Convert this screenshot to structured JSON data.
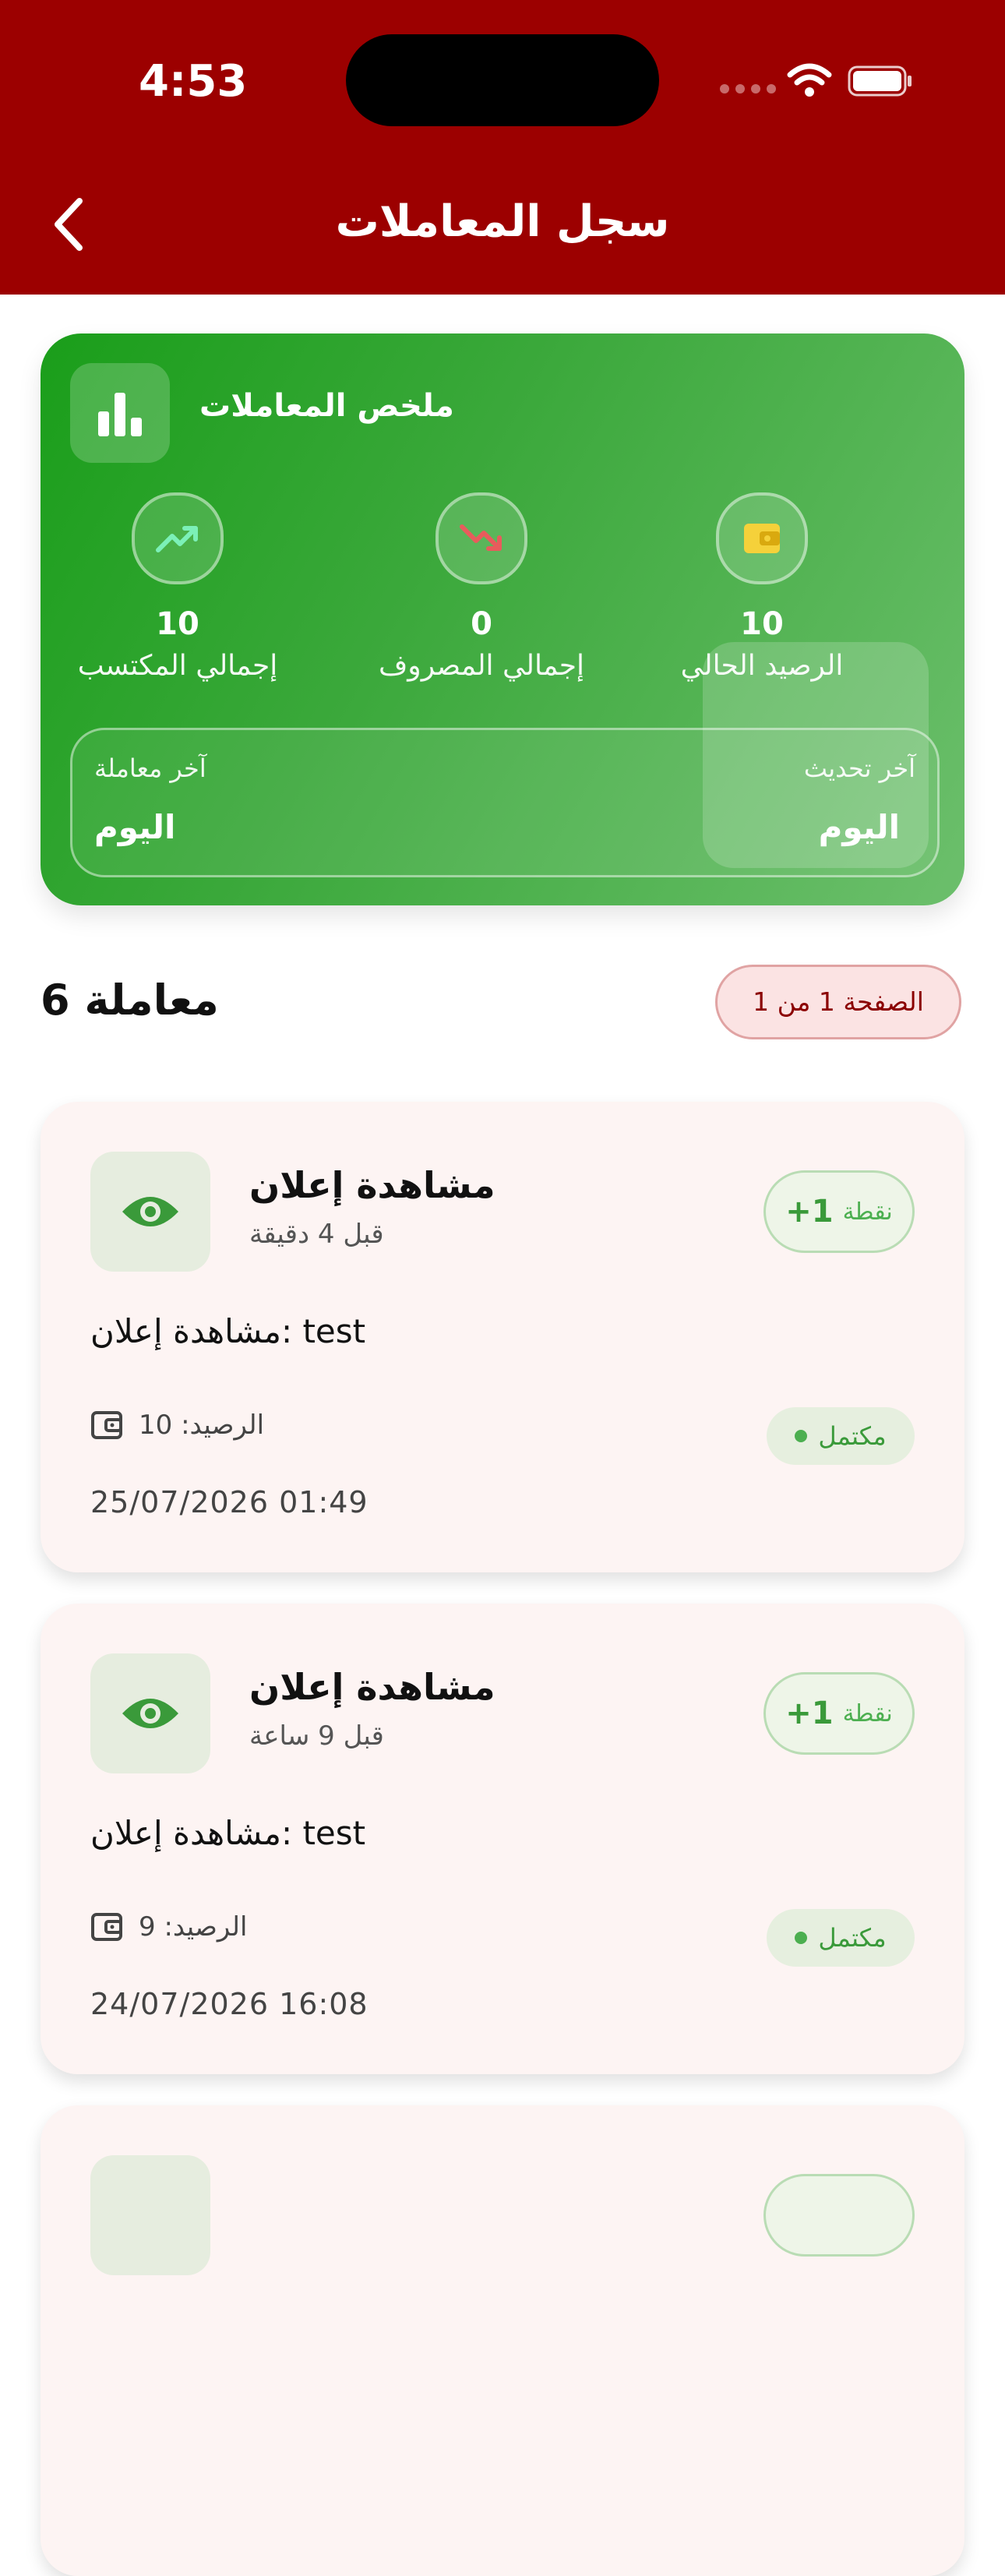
{
  "status_bar": {
    "time": "4:53"
  },
  "header": {
    "title": "سجل المعاملات"
  },
  "summary": {
    "title": "ملخص المعاملات",
    "stats": [
      {
        "label": "إجمالي المكتسب",
        "value": "10",
        "icon": "trending-up-icon"
      },
      {
        "label": "إجمالي المصروف",
        "value": "0",
        "icon": "trending-down-icon"
      },
      {
        "label": "الرصيد الحالي",
        "value": "10",
        "icon": "wallet-icon"
      }
    ],
    "last_transaction_label": "آخر معاملة",
    "last_transaction_value": "اليوم",
    "last_update_label": "آخر تحديث",
    "last_update_value": "اليوم"
  },
  "list": {
    "count_label": "6 معاملة",
    "page_label": "الصفحة 1 من 1"
  },
  "transactions": [
    {
      "title": "مشاهدة إعلان",
      "time_ago": "قبل 4 دقيقة",
      "points_label": "نقطة",
      "points_value": "+1",
      "description": "مشاهدة إعلان: test",
      "balance": "الرصيد: 10",
      "status": "مكتمل",
      "date": "25/07/2026 01:49"
    },
    {
      "title": "مشاهدة إعلان",
      "time_ago": "قبل 9 ساعة",
      "points_label": "نقطة",
      "points_value": "+1",
      "description": "مشاهدة إعلان: test",
      "balance": "الرصيد: 9",
      "status": "مكتمل",
      "date": "24/07/2026 16:08"
    }
  ],
  "colors": {
    "header": "#9c0000",
    "summary_green": "#1a9e1a",
    "accent_green": "#4caf50",
    "card_bg": "#fdf4f3"
  }
}
